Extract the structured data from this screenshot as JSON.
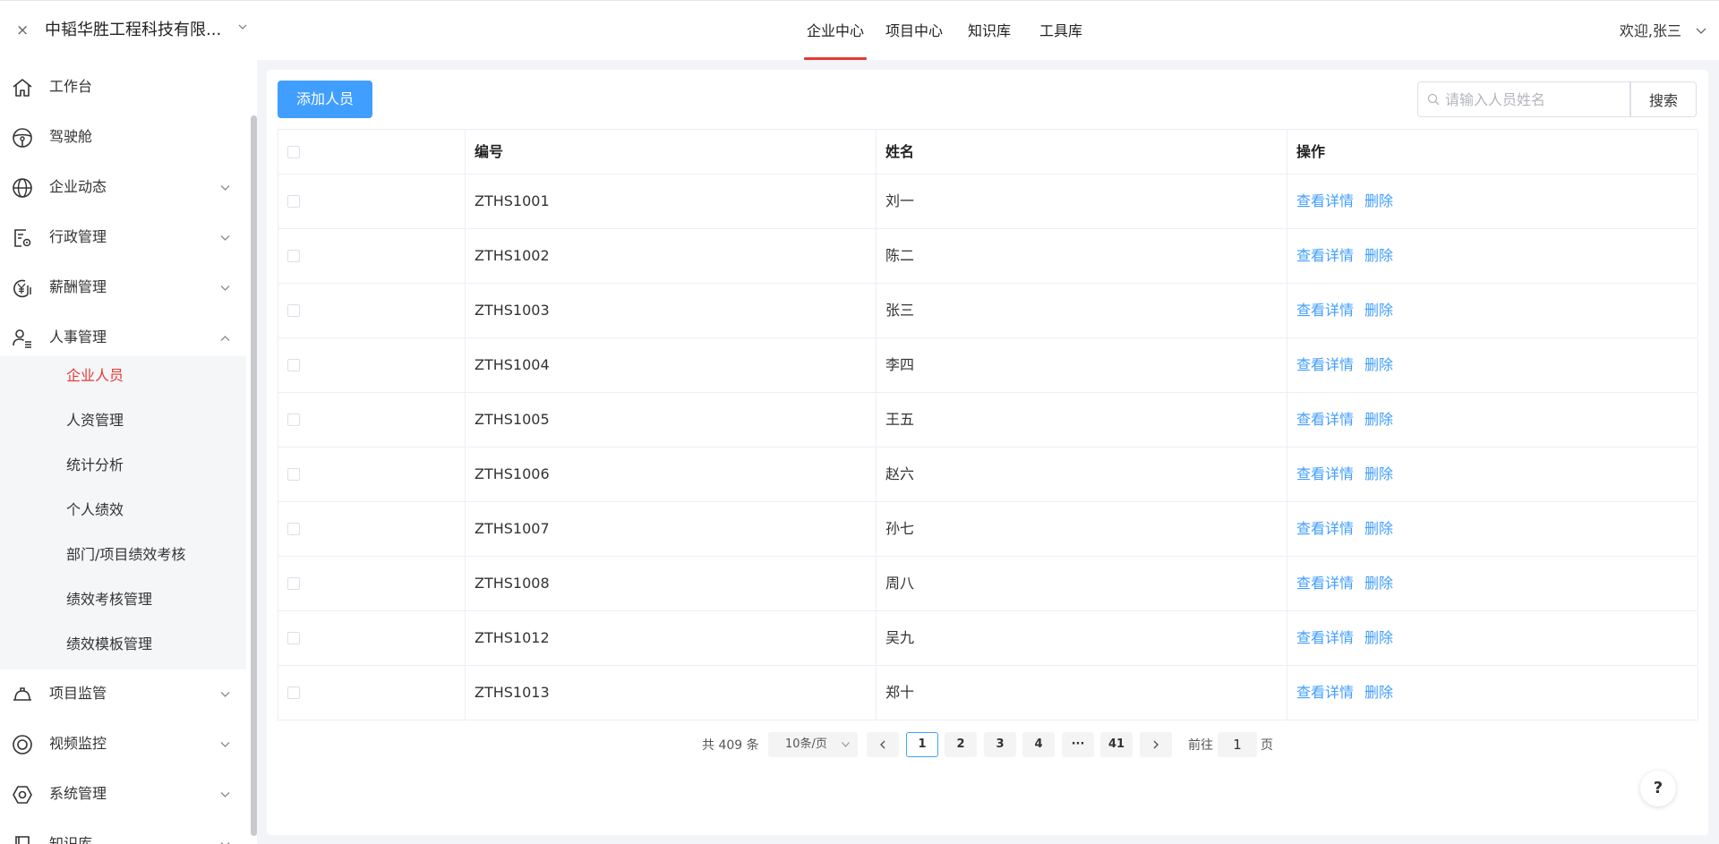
{
  "header": {
    "close_glyph": "×",
    "company": "中韬华胜工程科技有限...",
    "nav": [
      {
        "label": "企业中心",
        "active": true
      },
      {
        "label": "项目中心",
        "active": false
      },
      {
        "label": "知识库",
        "active": false
      },
      {
        "label": "工具库",
        "active": false
      }
    ],
    "welcome": "欢迎,张三",
    "accent_color": "#e53935"
  },
  "sidebar": {
    "items": [
      {
        "label": "工作台",
        "icon": "home-icon"
      },
      {
        "label": "驾驶舱",
        "icon": "steering-wheel-icon"
      },
      {
        "label": "企业动态",
        "icon": "globe-icon"
      },
      {
        "label": "行政管理",
        "icon": "document-gear-icon"
      },
      {
        "label": "薪酬管理",
        "icon": "yuan-icon"
      },
      {
        "label": "人事管理",
        "icon": "user-list-icon"
      }
    ],
    "submenu": [
      {
        "label": "企业人员",
        "active": true
      },
      {
        "label": "人资管理",
        "active": false
      },
      {
        "label": "统计分析",
        "active": false
      },
      {
        "label": "个人绩效",
        "active": false
      },
      {
        "label": "部门/项目绩效考核",
        "active": false
      },
      {
        "label": "绩效考核管理",
        "active": false
      },
      {
        "label": "绩效模板管理",
        "active": false
      }
    ],
    "items_after": [
      {
        "label": "项目监管",
        "icon": "hard-hat-icon"
      },
      {
        "label": "视频监控",
        "icon": "camera-icon"
      },
      {
        "label": "系统管理",
        "icon": "settings-hexagon-icon"
      },
      {
        "label": "知识库",
        "icon": "book-icon"
      }
    ]
  },
  "toolbar": {
    "add_label": "添加人员",
    "search_placeholder": "请输入人员姓名",
    "search_label": "搜索",
    "primary_color": "#409eff"
  },
  "table": {
    "headers": [
      "编号",
      "姓名",
      "操作"
    ],
    "action_detail": "查看详情",
    "action_delete": "删除",
    "rows": [
      {
        "id": "ZTHS1001",
        "name": "刘一"
      },
      {
        "id": "ZTHS1002",
        "name": "陈二"
      },
      {
        "id": "ZTHS1003",
        "name": "张三"
      },
      {
        "id": "ZTHS1004",
        "name": "李四"
      },
      {
        "id": "ZTHS1005",
        "name": "王五"
      },
      {
        "id": "ZTHS1006",
        "name": "赵六"
      },
      {
        "id": "ZTHS1007",
        "name": "孙七"
      },
      {
        "id": "ZTHS1008",
        "name": "周八"
      },
      {
        "id": "ZTHS1012",
        "name": "吴九"
      },
      {
        "id": "ZTHS1013",
        "name": "郑十"
      }
    ]
  },
  "pagination": {
    "total": "共 409 条",
    "page_size": "10条/页",
    "pages": [
      "1",
      "2",
      "3",
      "4",
      "···",
      "41"
    ],
    "current": "1",
    "goto_prefix": "前往",
    "goto_value": "1",
    "goto_suffix": "页"
  },
  "help_label": "?"
}
